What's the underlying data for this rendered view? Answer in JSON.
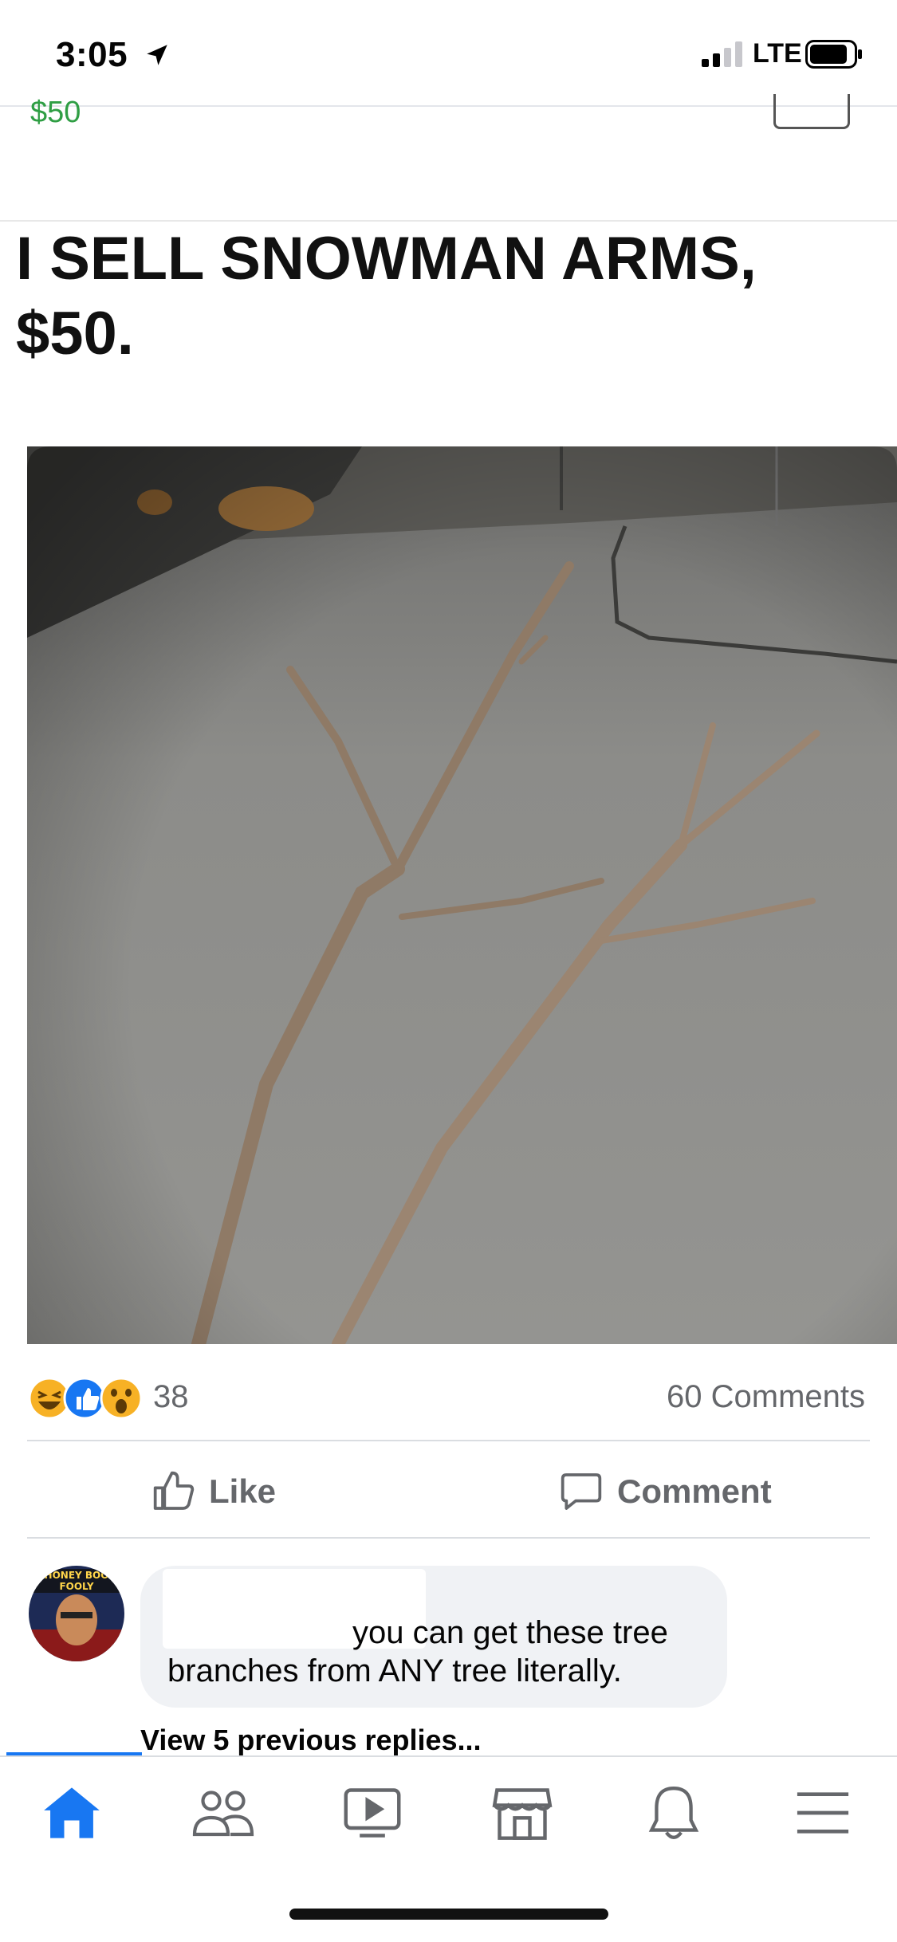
{
  "status_bar": {
    "time": "3:05",
    "network": "LTE",
    "icons": [
      "location-arrow-icon",
      "signal-icon",
      "battery-icon"
    ]
  },
  "listing": {
    "price_peek": "$50"
  },
  "post": {
    "caption_line1": "I SELL SNOWMAN ARMS,",
    "caption_line2": "$50."
  },
  "reactions": {
    "icons": [
      "haha-icon",
      "like-reaction-icon",
      "wow-icon"
    ],
    "count": "38",
    "comments": "60 Comments"
  },
  "actions": {
    "like_label": "Like",
    "comment_label": "Comment"
  },
  "comment": {
    "avatar_text": "HONEY BOO FOOLY",
    "text_line1": "you can get these tree",
    "text_line2": "branches from ANY tree literally.",
    "view_replies": "View 5 previous replies..."
  },
  "bottom_nav": {
    "items": [
      "home-icon",
      "friends-icon",
      "watch-icon",
      "marketplace-icon",
      "notifications-icon",
      "menu-icon"
    ]
  },
  "colors": {
    "accent": "#1877f2",
    "price_green": "#2f9e44",
    "secondary_text": "#65676b",
    "bubble": "#f0f2f5"
  }
}
